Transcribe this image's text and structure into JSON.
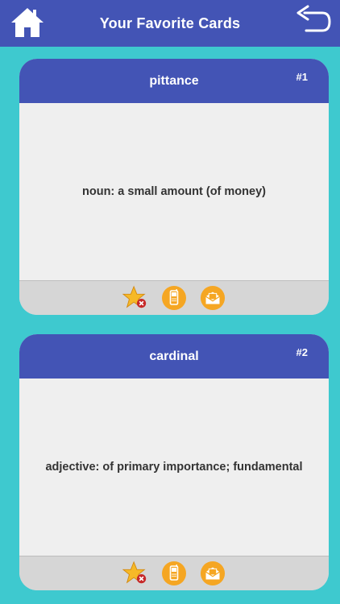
{
  "header": {
    "title": "Your Favorite Cards",
    "home_icon": "home-icon",
    "back_icon": "back-arrow-icon"
  },
  "colors": {
    "background": "#3ec9cf",
    "header": "#4354b5",
    "card_body": "#efefef",
    "action_bar": "#d6d6d6",
    "action_orange": "#f5a623"
  },
  "cards": [
    {
      "word": "pittance",
      "number": "#1",
      "definition": "noun: a small amount (of money)",
      "actions": [
        "unfavorite-star-icon",
        "phone-icon",
        "email-icon"
      ]
    },
    {
      "word": "cardinal",
      "number": "#2",
      "definition": "adjective: of primary importance; fundamental",
      "actions": [
        "unfavorite-star-icon",
        "phone-icon",
        "email-icon"
      ]
    }
  ]
}
